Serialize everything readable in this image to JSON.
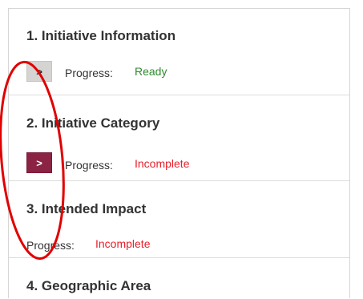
{
  "sections": [
    {
      "title": "1. Initiative Information",
      "button_label": ">",
      "progress_label": "Progress:",
      "status": "Ready"
    },
    {
      "title": "2. Initiative Category",
      "button_label": ">",
      "progress_label": "Progress:",
      "status": "Incomplete"
    },
    {
      "title": "3. Intended Impact",
      "progress_label": "Progress:",
      "status": "Incomplete"
    },
    {
      "title": "4. Geographic Area"
    }
  ],
  "colors": {
    "ready": "#2e8b2e",
    "incomplete": "#e8202c",
    "active_button": "#8b2344",
    "inactive_button": "#d6d4d2",
    "annotation": "#e00000"
  }
}
